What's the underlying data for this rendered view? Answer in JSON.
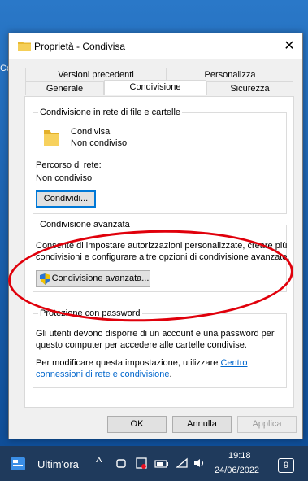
{
  "desktop": {
    "edge_text": "Co"
  },
  "window": {
    "title": "Proprietà - Condivisa",
    "close_glyph": "✕"
  },
  "tabs": [
    {
      "label": "Versioni precedenti"
    },
    {
      "label": "Personalizza"
    },
    {
      "label": "Generale"
    },
    {
      "label": "Condivisione"
    },
    {
      "label": "Sicurezza"
    }
  ],
  "network_sharing": {
    "group_title": "Condivisione in rete di file e cartelle",
    "folder_name": "Condivisa",
    "folder_state": "Non condiviso",
    "network_path_label": "Percorso di rete:",
    "network_path_value": "Non condiviso",
    "share_button": "Condividi..."
  },
  "advanced_sharing": {
    "group_title": "Condivisione avanzata",
    "description_line1": "Consente di impostare autorizzazioni personalizzate, creare più",
    "description_line2": "condivisioni e configurare altre opzioni di condivisione avanzate.",
    "button": "Condivisione avanzata..."
  },
  "password_protection": {
    "group_title": "Protezione con password",
    "line1": "Gli utenti devono disporre di un account e una password per",
    "line2": "questo computer per accedere alle cartelle condivise.",
    "line3_prefix": "Per modificare questa impostazione, utilizzare ",
    "link_part1": "Centro",
    "link_part2": "connessioni di rete e condivisione",
    "line4_suffix": "."
  },
  "buttons": {
    "ok": "OK",
    "cancel": "Annulla",
    "apply": "Applica"
  },
  "taskbar": {
    "news_label": "Ultim'ora",
    "time": "19:18",
    "date": "24/06/2022",
    "notification_count": "9",
    "chevron_glyph": "^"
  },
  "colors": {
    "highlight_ring": "#e0000b",
    "link": "#0066cc",
    "focus": "#0078d7",
    "taskbar": "#1f3a5c"
  }
}
